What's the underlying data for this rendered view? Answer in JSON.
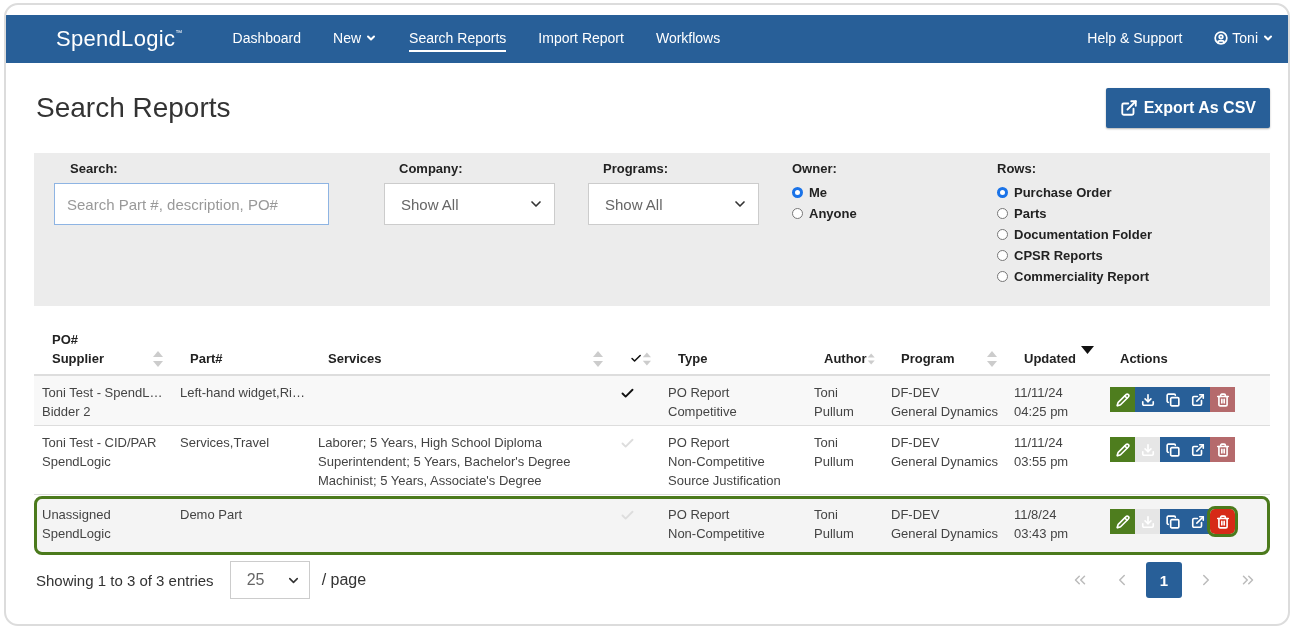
{
  "nav": {
    "logo": "SpendLogic",
    "logo_mark": "™",
    "items": [
      {
        "label": "Dashboard",
        "selected": false,
        "dropdown": false
      },
      {
        "label": "New",
        "selected": false,
        "dropdown": true
      },
      {
        "label": "Search Reports",
        "selected": true,
        "dropdown": false
      },
      {
        "label": "Import Report",
        "selected": false,
        "dropdown": false
      },
      {
        "label": "Workflows",
        "selected": false,
        "dropdown": false
      }
    ],
    "help": "Help & Support",
    "user": "Toni"
  },
  "page_title": "Search Reports",
  "export_button": "Export As CSV",
  "filters": {
    "search": {
      "label": "Search:",
      "placeholder": "Search Part #, description, PO#"
    },
    "company": {
      "label": "Company:",
      "value": "Show All"
    },
    "programs": {
      "label": "Programs:",
      "value": "Show All"
    },
    "owner": {
      "label": "Owner:",
      "options": [
        {
          "label": "Me",
          "selected": true
        },
        {
          "label": "Anyone",
          "selected": false
        }
      ]
    },
    "rows": {
      "label": "Rows:",
      "options": [
        {
          "label": "Purchase Order",
          "selected": true
        },
        {
          "label": "Parts",
          "selected": false
        },
        {
          "label": "Documentation Folder",
          "selected": false
        },
        {
          "label": "CPSR Reports",
          "selected": false
        },
        {
          "label": "Commerciality Report",
          "selected": false
        }
      ]
    }
  },
  "table": {
    "columns": [
      {
        "lines": [
          "PO#",
          "Supplier"
        ],
        "sortable": true
      },
      {
        "lines": [
          "Part#"
        ]
      },
      {
        "lines": [
          "Services"
        ],
        "sortable": true
      },
      {
        "kind": "check",
        "sortable": true
      },
      {
        "lines": [
          "Type"
        ]
      },
      {
        "lines": [
          "Author"
        ],
        "sortable": true
      },
      {
        "lines": [
          "Program"
        ],
        "sortable": true
      },
      {
        "lines": [
          "Updated"
        ],
        "sorted_descending": true
      },
      {
        "lines": [
          "Actions"
        ]
      }
    ],
    "rows": [
      {
        "po": "Toni Test - SpendL…",
        "supplier": "Bidder 2",
        "part": "Left-hand widget,Ri…",
        "services": [],
        "checked": true,
        "type": [
          "PO Report",
          "Competitive"
        ],
        "author": [
          "Toni",
          "Pullum"
        ],
        "program": [
          "DF-DEV",
          "General Dynamics"
        ],
        "updated": [
          "11/11/24",
          "04:25 pm"
        ],
        "highlighted": false,
        "actions": [
          {
            "kind": "edit",
            "disabled": false,
            "highlighted": false
          },
          {
            "kind": "download",
            "disabled": false,
            "highlighted": false
          },
          {
            "kind": "copy",
            "disabled": false,
            "highlighted": false
          },
          {
            "kind": "open",
            "disabled": false,
            "highlighted": false
          },
          {
            "kind": "delete",
            "disabled": false,
            "highlighted": false
          }
        ]
      },
      {
        "po": "Toni Test - CID/PAR",
        "supplier": "SpendLogic",
        "part": "Services,Travel",
        "services": [
          "Laborer; 5 Years, High School Diploma",
          "Superintendent; 5 Years, Bachelor's Degree",
          "Machinist; 5 Years, Associate's Degree"
        ],
        "checked": false,
        "type": [
          "PO Report",
          "Non-Competitive",
          "Source Justification"
        ],
        "author": [
          "Toni",
          "Pullum"
        ],
        "program": [
          "DF-DEV",
          "General Dynamics"
        ],
        "updated": [
          "11/11/24",
          "03:55 pm"
        ],
        "highlighted": false,
        "actions": [
          {
            "kind": "edit",
            "disabled": false,
            "highlighted": false
          },
          {
            "kind": "download",
            "disabled": true,
            "highlighted": false
          },
          {
            "kind": "copy",
            "disabled": false,
            "highlighted": false
          },
          {
            "kind": "open",
            "disabled": false,
            "highlighted": false
          },
          {
            "kind": "delete",
            "disabled": false,
            "highlighted": false
          }
        ]
      },
      {
        "po": "Unassigned",
        "supplier": "SpendLogic",
        "part": "Demo Part",
        "services": [],
        "checked": false,
        "type": [
          "PO Report",
          "Non-Competitive"
        ],
        "author": [
          "Toni",
          "Pullum"
        ],
        "program": [
          "DF-DEV",
          "General Dynamics"
        ],
        "updated": [
          "11/8/24",
          "03:43 pm"
        ],
        "highlighted": true,
        "actions": [
          {
            "kind": "edit",
            "disabled": false,
            "highlighted": false
          },
          {
            "kind": "download",
            "disabled": true,
            "highlighted": false
          },
          {
            "kind": "copy",
            "disabled": false,
            "highlighted": false
          },
          {
            "kind": "open",
            "disabled": false,
            "highlighted": false
          },
          {
            "kind": "delete",
            "disabled": false,
            "highlighted": true
          }
        ]
      }
    ]
  },
  "footer": {
    "info": "Showing 1 to 3 of 3 entries",
    "page_size": "25",
    "page_size_suffix": "/ page",
    "pages": [
      {
        "label": "1",
        "selected": true
      }
    ]
  }
}
